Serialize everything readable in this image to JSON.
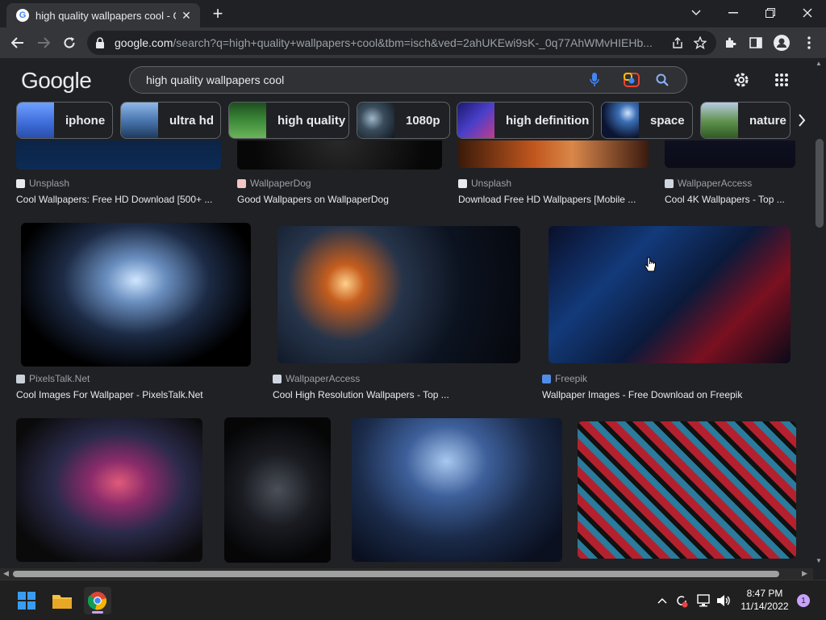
{
  "browser": {
    "tab_title": "high quality wallpapers cool - Go",
    "favicon_letter": "G",
    "url_host": "google.com",
    "url_rest": "/search?q=high+quality+wallpapers+cool&tbm=isch&ved=2ahUKEwi9sK-_0q77AhWMvHIEHb...",
    "new_tab": "+",
    "close_glyph": "✕"
  },
  "google": {
    "logo": "Google",
    "search_query": "high quality wallpapers cool"
  },
  "chips": [
    {
      "label": "iphone"
    },
    {
      "label": "ultra hd"
    },
    {
      "label": "high quality"
    },
    {
      "label": "1080p"
    },
    {
      "label": "high definition"
    },
    {
      "label": "space"
    },
    {
      "label": "nature"
    }
  ],
  "results": [
    {
      "source": "Unsplash",
      "title": "Cool Wallpapers: Free HD Download [500+ ..."
    },
    {
      "source": "WallpaperDog",
      "title": "Good Wallpapers on WallpaperDog"
    },
    {
      "source": "Unsplash",
      "title": "Download Free HD Wallpapers [Mobile ..."
    },
    {
      "source": "WallpaperAccess",
      "title": "Cool 4K Wallpapers - Top ..."
    },
    {
      "source": "PixelsTalk.Net",
      "title": "Cool Images For Wallpaper - PixelsTalk.Net"
    },
    {
      "source": "WallpaperAccess",
      "title": "Cool High Resolution Wallpapers - Top ..."
    },
    {
      "source": "Freepik",
      "title": "Wallpaper Images - Free Download on Freepik"
    }
  ],
  "taskbar": {
    "time": "8:47 PM",
    "date": "11/14/2022",
    "notifications": "1"
  },
  "colors": {
    "background": "#202124",
    "toolbar": "#35363a",
    "text": "#e8eaed",
    "muted": "#9aa0a6",
    "accent_blue": "#8ab4f8"
  }
}
